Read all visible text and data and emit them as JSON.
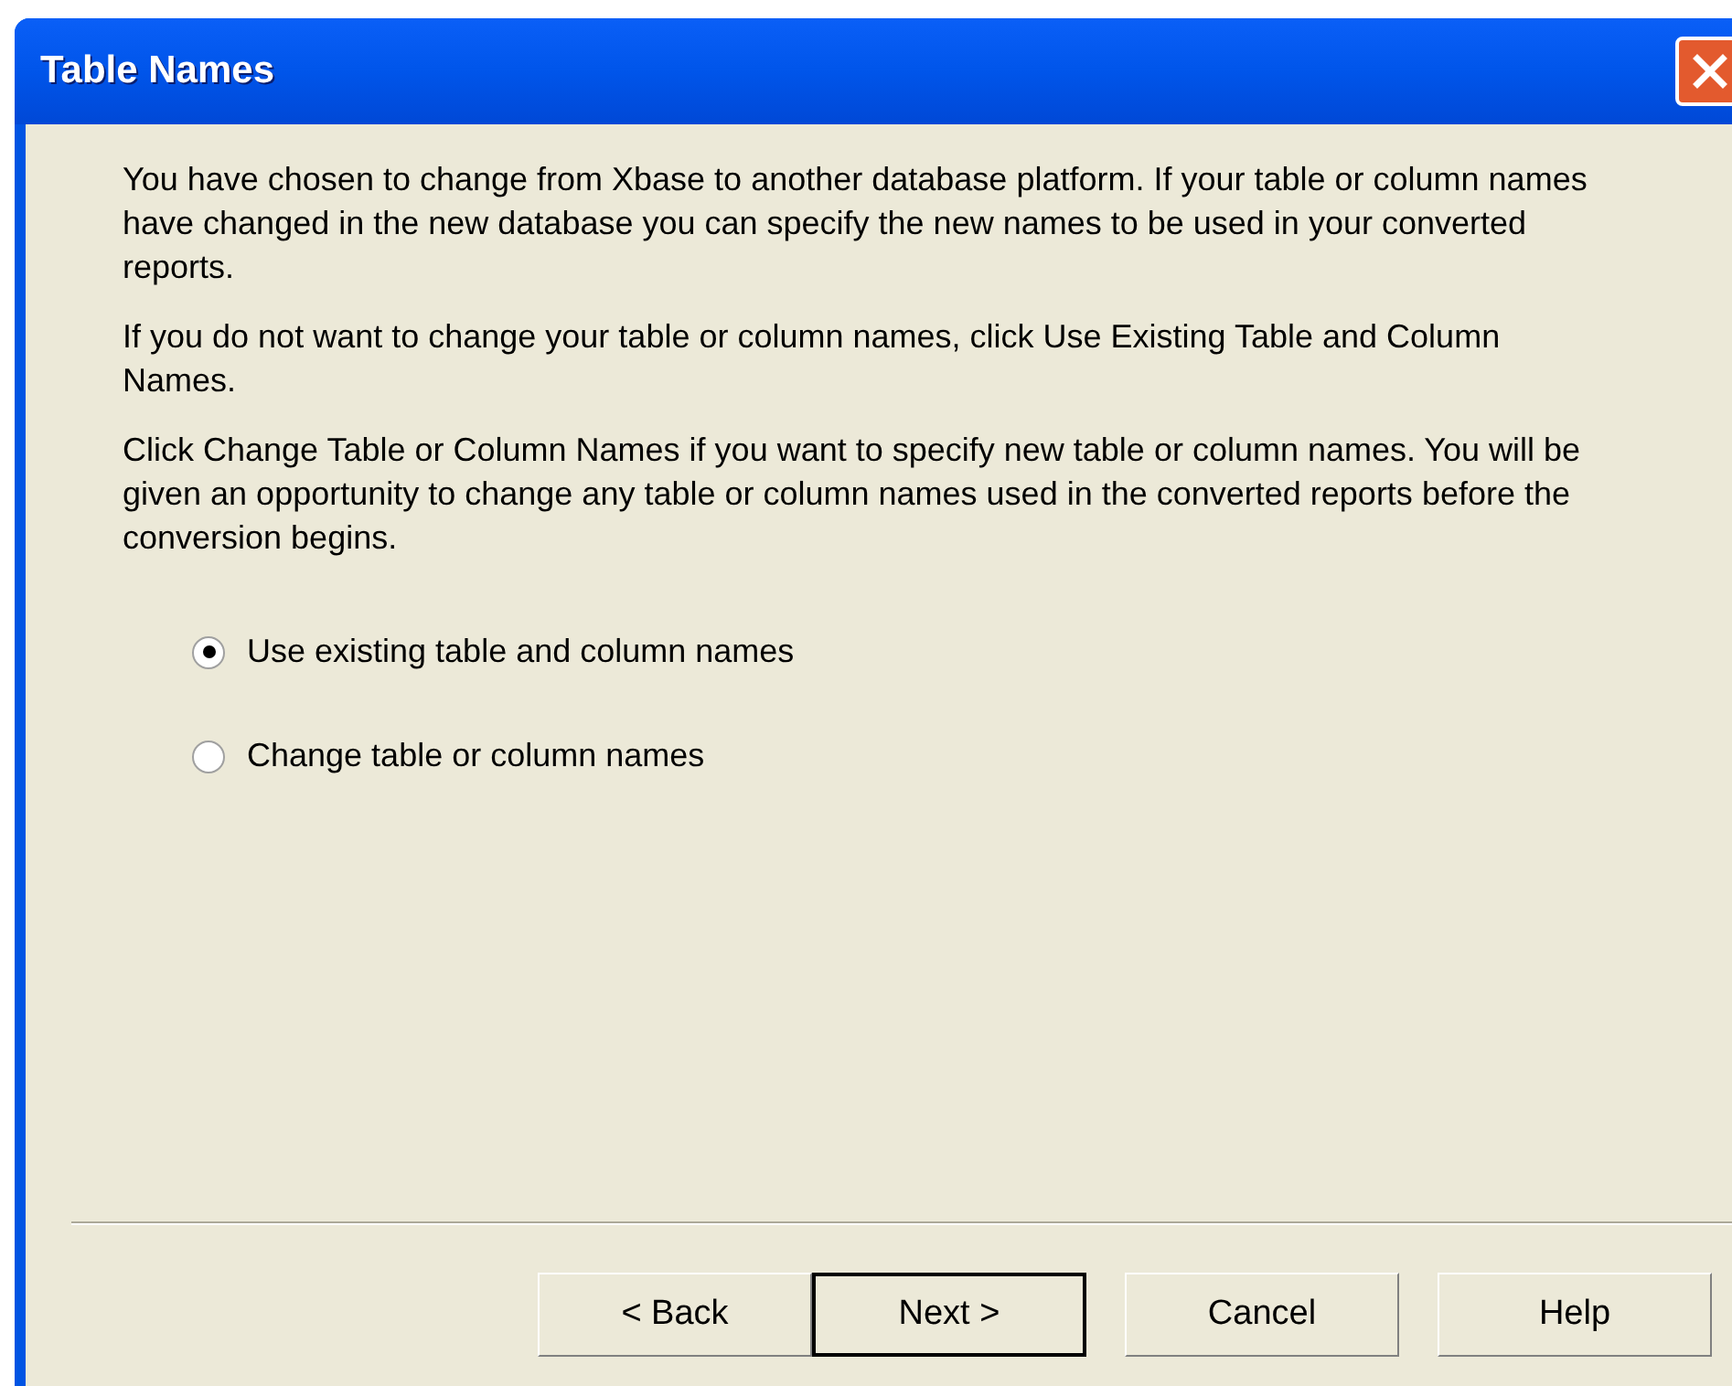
{
  "window": {
    "title": "Table Names"
  },
  "paragraphs": [
    "You have chosen to change from Xbase to another database platform.  If your table or column names have changed in the new database you can specify the new names to be used in your converted reports.",
    "If you do not want to change your table or column names, click Use Existing Table and Column Names.",
    "Click Change Table or Column Names if you want to specify new table or column names.  You will be given an opportunity to change any table or column names used in the converted reports before the conversion begins."
  ],
  "options": [
    {
      "label": "Use existing table and column names",
      "selected": true
    },
    {
      "label": "Change table or column names",
      "selected": false
    }
  ],
  "buttons": [
    {
      "label": "< Back",
      "default": false
    },
    {
      "label": "Next >",
      "default": true
    },
    {
      "label": "Cancel",
      "default": false
    },
    {
      "label": "Help",
      "default": false
    }
  ]
}
